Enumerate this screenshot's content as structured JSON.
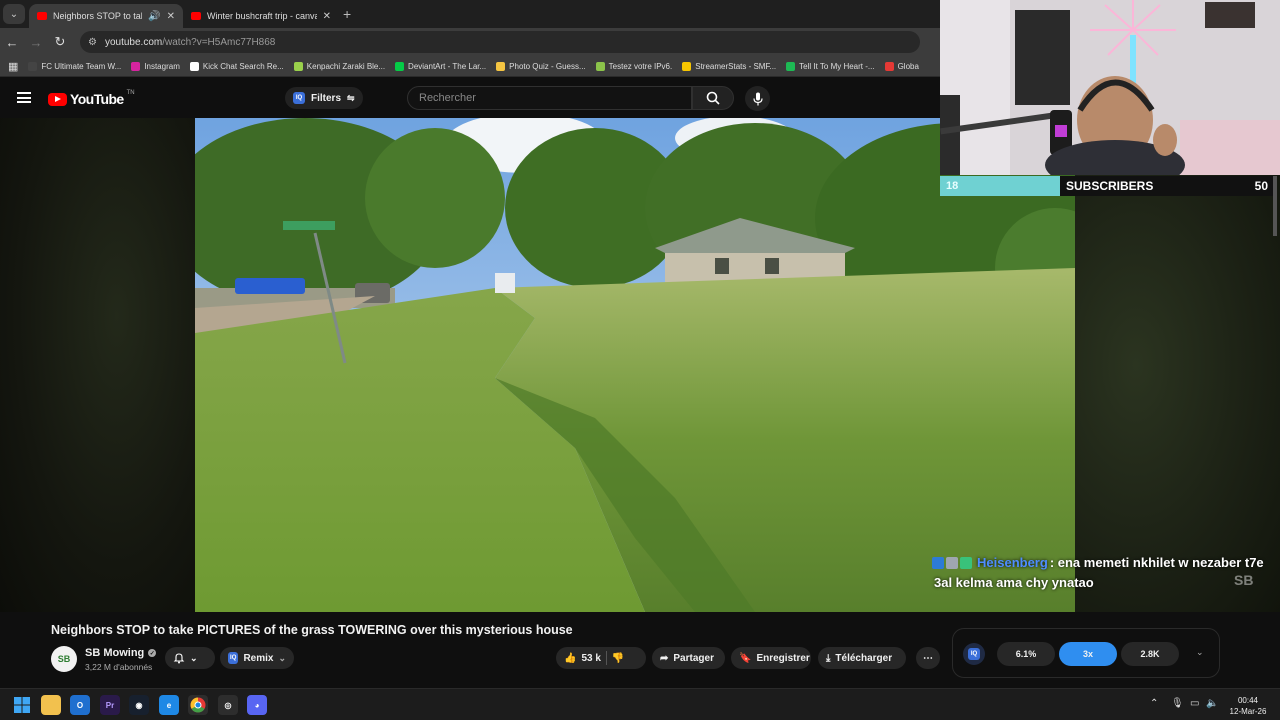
{
  "browser": {
    "tabs": [
      {
        "title": "Neighbors STOP to take PI",
        "active": true
      },
      {
        "title": "Winter bushcraft trip - canvas",
        "active": false
      }
    ],
    "address": {
      "host": "youtube.com",
      "path": "/watch?v=H5Amc77H868"
    },
    "bookmarks": [
      {
        "label": "FC Ultimate Team W...",
        "color": "#444444"
      },
      {
        "label": "Instagram",
        "color": "#d6249f"
      },
      {
        "label": "Kick Chat Search Re...",
        "color": "#ffffff"
      },
      {
        "label": "Kenpachi Zaraki Ble...",
        "color": "#9ad14b"
      },
      {
        "label": "DeviantArt - The Lar...",
        "color": "#05cc47"
      },
      {
        "label": "Photo Quiz - Guess...",
        "color": "#f5c542"
      },
      {
        "label": "Testez votre IPv6.",
        "color": "#8bc34a"
      },
      {
        "label": "StreamerStats - SMF...",
        "color": "#f7c600"
      },
      {
        "label": "Tell It To My Heart -...",
        "color": "#1db954"
      },
      {
        "label": "Globa",
        "color": "#e53935"
      }
    ]
  },
  "youtube": {
    "logo_text": "YouTube",
    "logo_tm": "TN",
    "filters_label": "Filters",
    "search_placeholder": "Rechercher"
  },
  "stream_overlay": {
    "sub_count": "18",
    "sub_label": "SUBSCRIBERS",
    "sub_goal": "50",
    "sub_fraction": 0.36,
    "chat": {
      "username": "Heisenberg",
      "message_line1": ": ena memeti nkhilet w nezaber t7e",
      "message_line2": "3al kelma ama chy ynatao"
    },
    "watermark": "SB"
  },
  "video": {
    "title": "Neighbors STOP to take PICTURES of the grass TOWERING over this mysterious house",
    "channel": {
      "name": "SB Mowing",
      "subs": "3,22 M d'abonnés",
      "avatar_text": "SB"
    },
    "remix_label": "Remix",
    "likes": "53 k",
    "share_label": "Partager",
    "save_label": "Enregistrer",
    "download_label": "Télécharger"
  },
  "iq_widget": {
    "logo": "IQ",
    "values": [
      "6.1%",
      "3x",
      "2.8K"
    ],
    "selected_index": 1
  },
  "taskbar": {
    "time": "00:44",
    "date": "12-Mar-26"
  },
  "colors": {
    "youtube_red": "#ff0000",
    "subbar_fill": "#6fd1d2",
    "chat_username": "#4e8cff",
    "iq_active": "#2f8ef0"
  }
}
